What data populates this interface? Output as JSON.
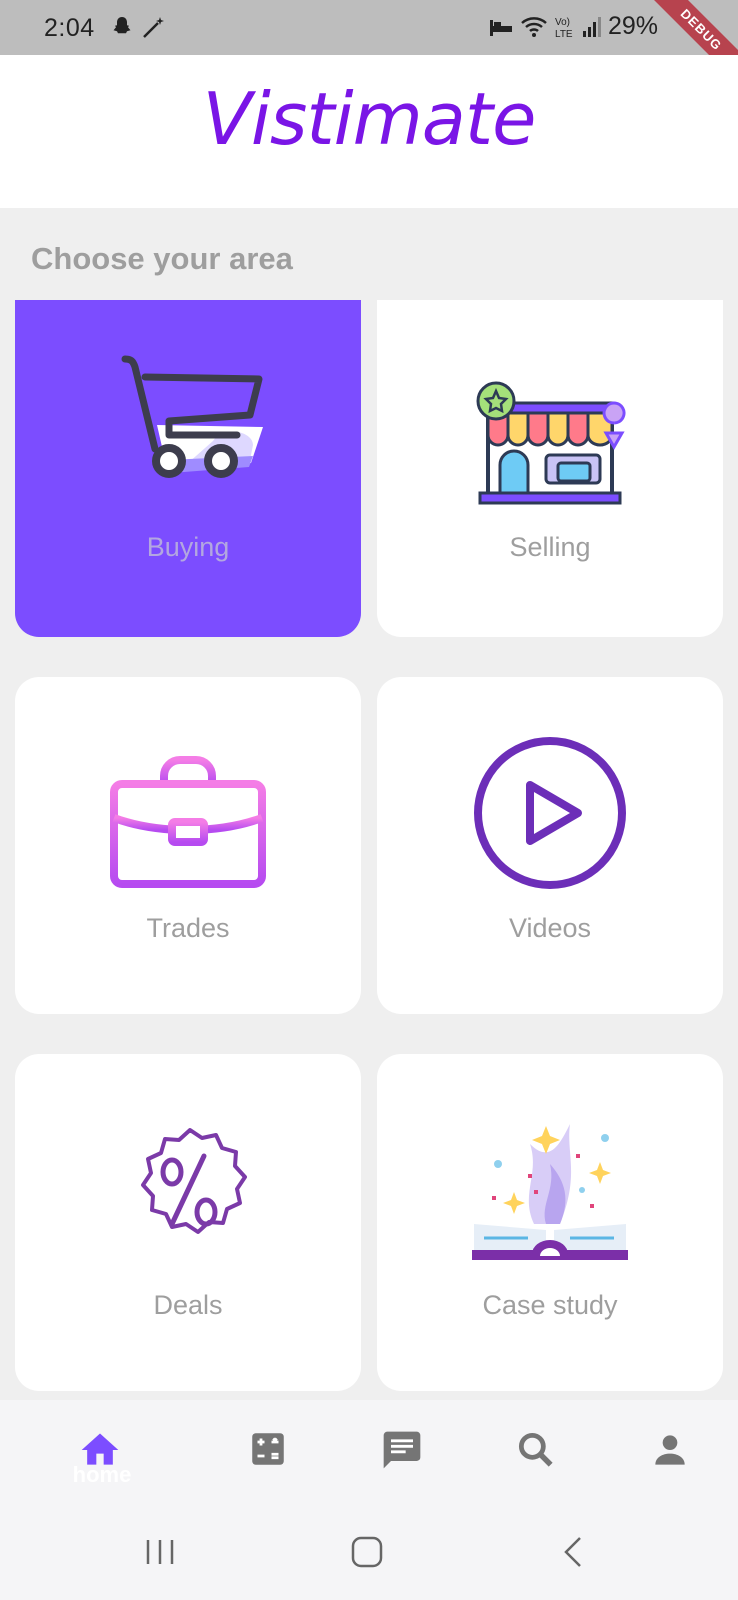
{
  "status_bar": {
    "time": "2:04",
    "battery": "29%",
    "debug_banner": "DEBUG"
  },
  "header": {
    "logo_text": "Vistimate"
  },
  "section": {
    "title": "Choose your area"
  },
  "cards": [
    {
      "label": "Buying",
      "icon": "shopping-cart-icon",
      "active": true
    },
    {
      "label": "Selling",
      "icon": "storefront-icon",
      "active": false
    },
    {
      "label": "Trades",
      "icon": "briefcase-icon",
      "active": false
    },
    {
      "label": "Videos",
      "icon": "play-circle-icon",
      "active": false
    },
    {
      "label": "Deals",
      "icon": "discount-badge-icon",
      "active": false
    },
    {
      "label": "Case study",
      "icon": "magic-book-icon",
      "active": false
    }
  ],
  "bottom_nav": {
    "items": [
      {
        "icon": "home-icon",
        "label": "home",
        "selected": true
      },
      {
        "icon": "calculator-icon"
      },
      {
        "icon": "chat-icon"
      },
      {
        "icon": "search-icon"
      },
      {
        "icon": "person-icon"
      }
    ]
  },
  "colors": {
    "brand": "#7a15e6",
    "active_card": "#7c4dff",
    "nav_active": "#7c4dff",
    "nav_inactive": "#757575"
  }
}
